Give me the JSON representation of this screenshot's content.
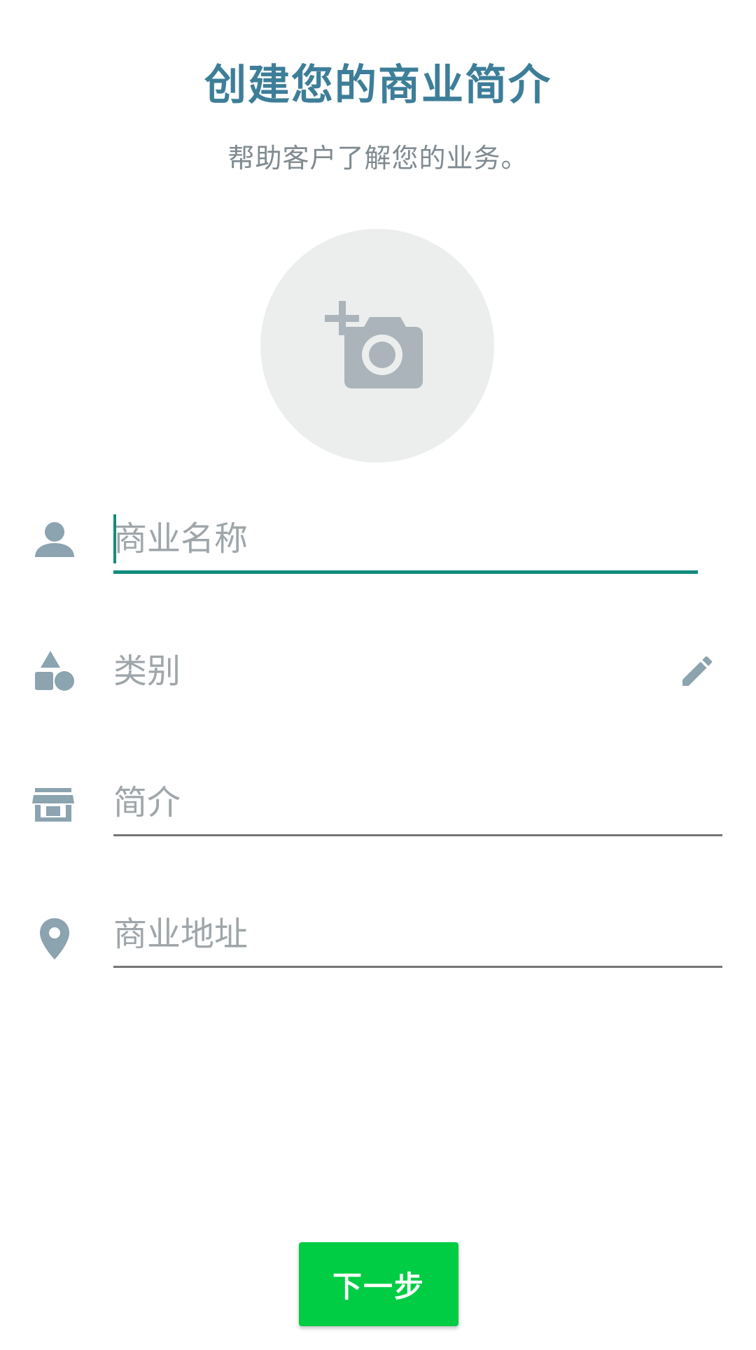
{
  "header": {
    "title": "创建您的商业简介",
    "subtitle": "帮助客户了解您的业务。"
  },
  "avatar": {
    "icon": "add-photo-camera-icon"
  },
  "form": {
    "business_name": {
      "icon": "person-icon",
      "placeholder": "商业名称",
      "value": ""
    },
    "category": {
      "icon": "category-shapes-icon",
      "label": "类别",
      "edit_icon": "pencil-icon"
    },
    "description": {
      "icon": "store-icon",
      "placeholder": "简介",
      "value": ""
    },
    "address": {
      "icon": "location-pin-icon",
      "placeholder": "商业地址",
      "value": ""
    }
  },
  "footer": {
    "next_label": "下一步"
  },
  "colors": {
    "title": "#3d7e99",
    "accent": "#128c7e",
    "button": "#00cc44",
    "icon": "#8ca3b0"
  }
}
